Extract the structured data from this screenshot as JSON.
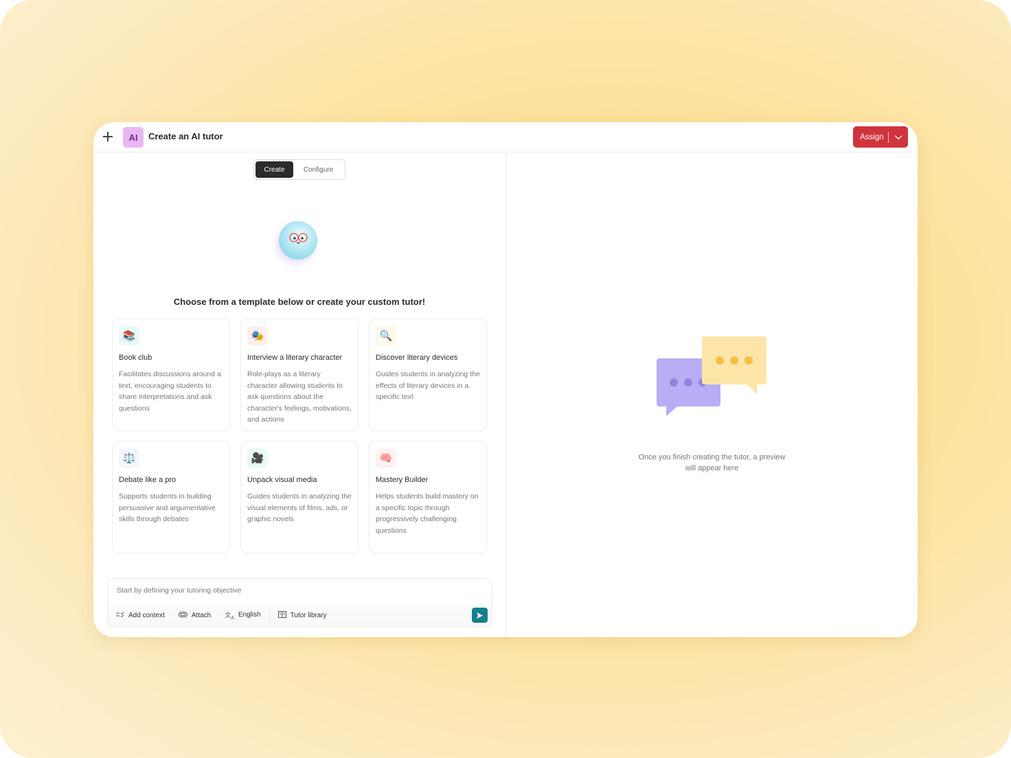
{
  "header": {
    "ai_badge": "AI",
    "title": "Create an AI tutor",
    "assign_label": "Assign"
  },
  "tabs": [
    {
      "label": "Create",
      "active": true
    },
    {
      "label": "Configure",
      "active": false
    }
  ],
  "headline": "Choose from a template below or create your custom tutor!",
  "templates": [
    {
      "icon": "books-icon",
      "glyph": "📚",
      "bg": "#eafaf5",
      "title": "Book club",
      "description": "Facilitates discussions around a text, encouraging students to share interpretations and ask questions"
    },
    {
      "icon": "theater-masks-icon",
      "glyph": "🎭",
      "bg": "#fdf0ec",
      "title": "Interview a literary character",
      "description": "Role-plays as a literary character allowing students to ask questions about the character's feelings, motivations, and actions"
    },
    {
      "icon": "magnifier-icon",
      "glyph": "🔍",
      "bg": "#fdf8ea",
      "title": "Discover literary devices",
      "description": "Guides students in analyzing the effects of literary devices in a specific text"
    },
    {
      "icon": "scales-icon",
      "glyph": "⚖️",
      "bg": "#f3f5fb",
      "title": "Debate like a pro",
      "description": "Supports students in building persuasive and argumentative skills through debates"
    },
    {
      "icon": "movie-camera-icon",
      "glyph": "🎥",
      "bg": "#eafaf7",
      "title": "Unpack visual media",
      "description": "Guides students in analyzing the visual elements of films, ads, or graphic novels"
    },
    {
      "icon": "brain-icon",
      "glyph": "🧠",
      "bg": "#fdf1f1",
      "title": "Mastery Builder",
      "description": "Helps students build mastery on a specific topic through progressively challenging questions"
    }
  ],
  "composer": {
    "placeholder": "Start by defining your tutoring objective",
    "tools": [
      {
        "icon": "checklist-icon",
        "glyph": "☷",
        "label": "Add context"
      },
      {
        "icon": "paperclip-icon",
        "glyph": "⊂⊃",
        "label": "Attach"
      },
      {
        "icon": "translate-icon",
        "glyph": "文A",
        "label": "English"
      },
      {
        "icon": "book-open-icon",
        "glyph": "▥",
        "label": "Tutor library"
      }
    ]
  },
  "preview": {
    "message_line1": "Once you finish creating the tutor, a preview",
    "message_line2": "will appear here"
  },
  "colors": {
    "accent_red": "#d0333d",
    "send_teal": "#157f8f",
    "ai_badge_bg": "#e9b8f2",
    "bubble_purple": "#b7aef5",
    "bubble_yellow": "#fde5a8"
  }
}
